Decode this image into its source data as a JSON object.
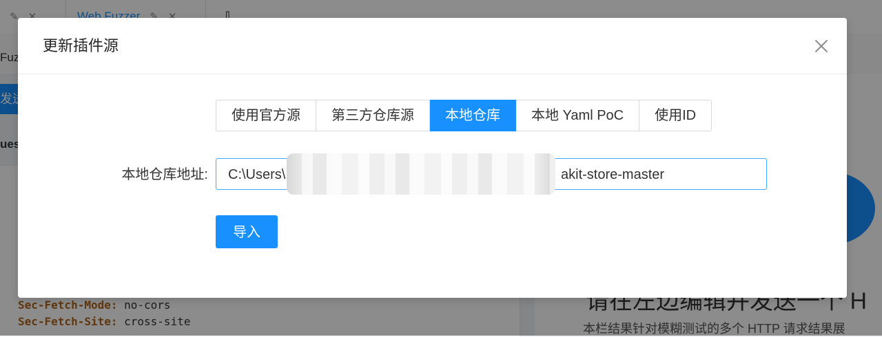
{
  "background": {
    "tabs": [
      {
        "label": "",
        "icons": [
          "edit-icon",
          "close-icon"
        ]
      },
      {
        "label": "Web Fuzzer",
        "icons": [
          "edit-icon",
          "close-icon"
        ]
      }
    ],
    "sub_label": "Fuz",
    "send_label": "发送",
    "request_label": "uest",
    "code_lines": [
      {
        "key": "Sec-Fetch-Mode:",
        "value": " no-cors"
      },
      {
        "key": "Sec-Fetch-Site:",
        "value": " cross-site"
      }
    ],
    "right_big": "请在左边编辑并发送一个 H",
    "right_desc": "本栏结果针对模糊测试的多个 HTTP 请求结果展"
  },
  "modal": {
    "title": "更新插件源",
    "source_options": [
      {
        "label": "使用官方源",
        "selected": false
      },
      {
        "label": "第三方仓库源",
        "selected": false
      },
      {
        "label": "本地仓库",
        "selected": true
      },
      {
        "label": "本地 Yaml PoC",
        "selected": false
      },
      {
        "label": "使用ID",
        "selected": false
      }
    ],
    "path_label": "本地仓库地址:",
    "path_value_prefix": "C:\\Users\\",
    "path_value_suffix": "akit-store-master",
    "import_label": "导入"
  },
  "colors": {
    "primary": "#1890ff",
    "mask": "rgba(0,0,0,0.45)"
  }
}
